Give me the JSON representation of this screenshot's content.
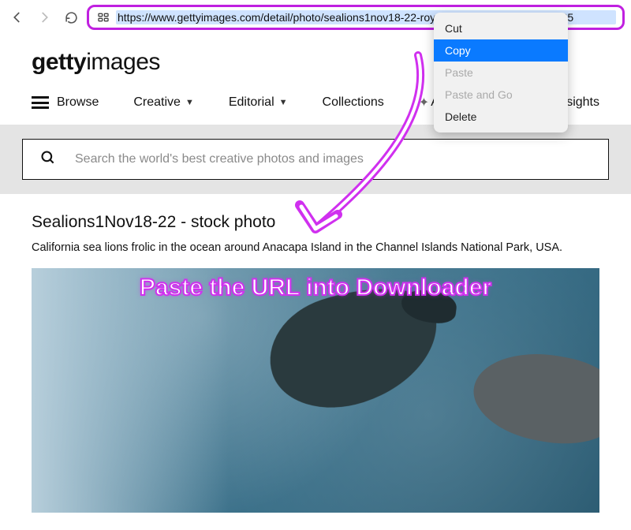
{
  "browser": {
    "url": "https://www.gettyimages.com/detail/photo/sealions1nov18-22-royalty-free-image/1456915125",
    "context_menu": [
      "Cut",
      "Copy",
      "Paste",
      "Paste and Go",
      "Delete"
    ],
    "context_selected_index": 1,
    "context_disabled_indices": [
      2,
      3
    ]
  },
  "logo": {
    "bold": "getty",
    "light": "images"
  },
  "nav": {
    "browse": "Browse",
    "items": [
      "Creative",
      "Editorial",
      "Collections",
      "AI Generator",
      "Insights"
    ]
  },
  "search": {
    "placeholder": "Search the world's best creative photos and images"
  },
  "page": {
    "title": "Sealions1Nov18-22 - stock photo",
    "description": "California sea lions frolic in the ocean around Anacapa Island in the Channel Islands National Park, USA."
  },
  "overlay": {
    "instruction": "Paste the URL into Downloader"
  }
}
